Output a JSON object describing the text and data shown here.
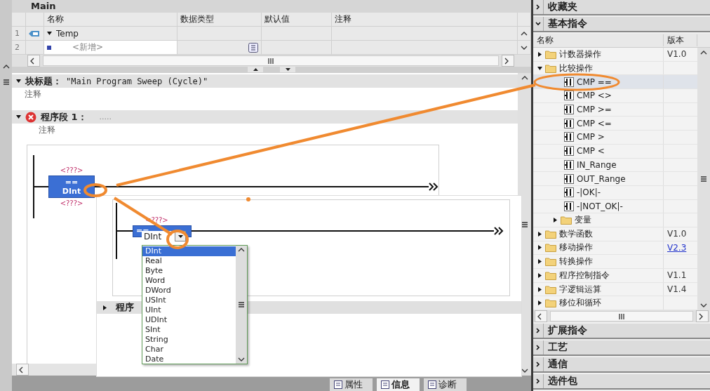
{
  "editor": {
    "title": "Main",
    "interface": {
      "columns": [
        "名称",
        "数据类型",
        "默认值",
        "注释"
      ],
      "rows": [
        {
          "index": "1",
          "kind": "section",
          "name": "Temp",
          "expanded": true
        },
        {
          "index": "2",
          "kind": "new",
          "placeholder": "<新增>"
        }
      ]
    },
    "block_title": {
      "label": "块标题：",
      "value": "\"Main Program Sweep (Cycle)\"",
      "comment": "注释",
      "expanded": true
    },
    "network": {
      "label": "程序段 1：",
      "title": ".....",
      "comment": "注释",
      "error": true,
      "expanded": true,
      "block": {
        "operand_top": "<???>",
        "operator": "==",
        "type": "DInt",
        "operand_bottom": "<???>"
      }
    }
  },
  "inset": {
    "block": {
      "operand_top": "<???>",
      "operator": "==",
      "type": "DInt"
    },
    "type_options": [
      {
        "label": "DInt",
        "selected": true
      },
      {
        "label": "Real",
        "selected": false
      },
      {
        "label": "Byte",
        "selected": false
      },
      {
        "label": "Word",
        "selected": false
      },
      {
        "label": "DWord",
        "selected": false
      },
      {
        "label": "USInt",
        "selected": false
      },
      {
        "label": "UInt",
        "selected": false
      },
      {
        "label": "UDInt",
        "selected": false
      },
      {
        "label": "SInt",
        "selected": false
      },
      {
        "label": "String",
        "selected": false
      },
      {
        "label": "Char",
        "selected": false
      },
      {
        "label": "Date",
        "selected": false
      }
    ],
    "next_network": {
      "label": "程序",
      "expanded": false
    }
  },
  "status_tabs": [
    {
      "label": "属性",
      "selected": false
    },
    {
      "label": "信息",
      "selected": true
    },
    {
      "label": "诊断",
      "selected": false
    }
  ],
  "panes": [
    {
      "title": "收藏夹",
      "expanded": false
    },
    {
      "title": "基本指令",
      "expanded": true,
      "columns": [
        "名称",
        "版本"
      ],
      "tree": [
        {
          "kind": "folder",
          "label": "计数器操作",
          "version": "V1.0",
          "linked": false,
          "expanded": false
        },
        {
          "kind": "folder",
          "label": "比较操作",
          "expanded": true,
          "children": [
            {
              "kind": "instruction",
              "label": "CMP ==",
              "selected": true
            },
            {
              "kind": "instruction",
              "label": "CMP <>",
              "selected": false
            },
            {
              "kind": "instruction",
              "label": "CMP >=",
              "selected": false
            },
            {
              "kind": "instruction",
              "label": "CMP <=",
              "selected": false
            },
            {
              "kind": "instruction",
              "label": "CMP >",
              "selected": false
            },
            {
              "kind": "instruction",
              "label": "CMP <",
              "selected": false
            },
            {
              "kind": "instruction",
              "label": "IN_Range",
              "selected": false
            },
            {
              "kind": "instruction",
              "label": "OUT_Range",
              "selected": false
            },
            {
              "kind": "instruction",
              "label": "-|OK|-",
              "selected": false
            },
            {
              "kind": "instruction",
              "label": "-|NOT_OK|-",
              "selected": false
            },
            {
              "kind": "folder",
              "label": "变量",
              "expanded": false
            }
          ]
        },
        {
          "kind": "folder",
          "label": "数学函数",
          "version": "V1.0",
          "linked": false,
          "expanded": false
        },
        {
          "kind": "folder",
          "label": "移动操作",
          "version": "V2.3",
          "linked": true,
          "expanded": false
        },
        {
          "kind": "folder",
          "label": "转换操作",
          "expanded": false
        },
        {
          "kind": "folder",
          "label": "程序控制指令",
          "version": "V1.1",
          "linked": false,
          "expanded": false
        },
        {
          "kind": "folder",
          "label": "字逻辑运算",
          "version": "V1.4",
          "linked": false,
          "expanded": false
        },
        {
          "kind": "folder",
          "label": "移位和循环",
          "expanded": false
        }
      ]
    },
    {
      "title": "扩展指令",
      "expanded": false
    },
    {
      "title": "工艺",
      "expanded": false
    },
    {
      "title": "通信",
      "expanded": false
    },
    {
      "title": "选件包",
      "expanded": false
    }
  ]
}
